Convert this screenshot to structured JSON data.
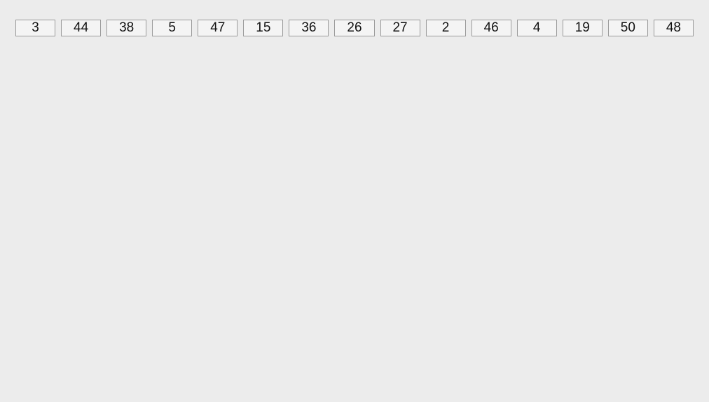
{
  "cells": [
    {
      "value": "3"
    },
    {
      "value": "44"
    },
    {
      "value": "38"
    },
    {
      "value": "5"
    },
    {
      "value": "47"
    },
    {
      "value": "15"
    },
    {
      "value": "36"
    },
    {
      "value": "26"
    },
    {
      "value": "27"
    },
    {
      "value": "2"
    },
    {
      "value": "46"
    },
    {
      "value": "4"
    },
    {
      "value": "19"
    },
    {
      "value": "50"
    },
    {
      "value": "48"
    }
  ]
}
